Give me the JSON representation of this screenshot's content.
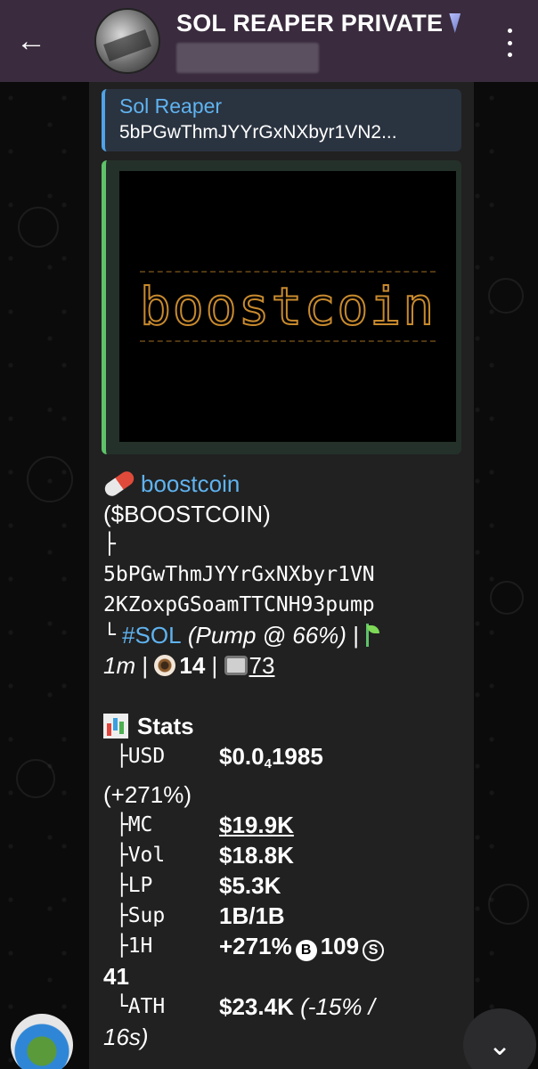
{
  "header": {
    "title": "SOL REAPER PRIVATE",
    "back_icon": "arrow-left-icon",
    "more_icon": "more-vertical-icon"
  },
  "reply": {
    "name": "Sol Reaper",
    "text": "5bPGwThmJYYrGxNXbyr1VN2..."
  },
  "media": {
    "logo_text": "boostcoin"
  },
  "message": {
    "token_name": "boostcoin",
    "ticker": "($BOOSTCOIN)",
    "tree_branch": "├",
    "address_line1": "5bPGwThmJYYrGxNXbyr1VN",
    "address_line2": "2KZoxpGSoamTTCNH93pump",
    "tree_end": "└",
    "chain_tag": "#SOL",
    "pump_info": "(Pump @ 66%)",
    "sep": "|",
    "age": "1m",
    "views": "14",
    "tv_count": "73",
    "stats_title": "Stats",
    "usd_key": "USD",
    "usd_val_prefix": "$0.0",
    "usd_val_sub": "4",
    "usd_val_suffix": "1985",
    "usd_change": "(+271%)",
    "mc_key": "MC",
    "mc_val": "$19.9K",
    "vol_key": "Vol",
    "vol_val": "$18.8K",
    "lp_key": "LP",
    "lp_val": "$5.3K",
    "sup_key": "Sup",
    "sup_val": "1B/1B",
    "h1_key": "1H",
    "h1_val": "+271%",
    "h1_buys": "109",
    "h1_sells": "41",
    "ath_key": "ATH",
    "ath_val": "$23.4K",
    "ath_change": "(-15% /",
    "ath_time": "16s)"
  },
  "colors": {
    "header_bg": "#3a2c3e",
    "link": "#5fb3f0",
    "bubble_bg": "#212121",
    "media_border": "#5fc26a"
  }
}
